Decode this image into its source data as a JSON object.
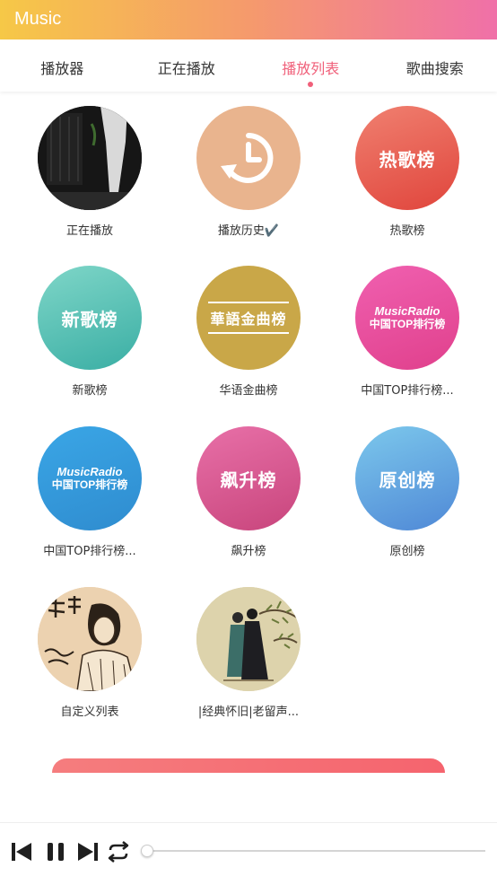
{
  "app": {
    "title": "Music"
  },
  "tabs": [
    {
      "label": "播放器"
    },
    {
      "label": "正在播放"
    },
    {
      "label": "播放列表"
    },
    {
      "label": "歌曲搜索"
    }
  ],
  "active_tab": "播放列表",
  "playlists": [
    {
      "label": "正在播放",
      "cover": "photo-dark-figure"
    },
    {
      "label": "播放历史✔️",
      "cover": "history-clock-icon"
    },
    {
      "label": "热歌榜",
      "cover_text": "热歌榜"
    },
    {
      "label": "新歌榜",
      "cover_text": "新歌榜"
    },
    {
      "label": "华语金曲榜",
      "cover_text": "華語金曲榜"
    },
    {
      "label": "中国TOP排行榜...",
      "cover_text_1": "MusicRadio",
      "cover_text_2": "中国TOP排行榜"
    },
    {
      "label": "中国TOP排行榜...",
      "cover_text_1": "MusicRadio",
      "cover_text_2": "中国TOP排行榜"
    },
    {
      "label": "飙升榜",
      "cover_text": "飙升榜"
    },
    {
      "label": "原创榜",
      "cover_text": "原创榜"
    },
    {
      "label": "自定义列表",
      "cover": "portrait-sketch"
    },
    {
      "label": "|经典怀旧|老留声...",
      "cover": "illustration-couple"
    }
  ],
  "colors": {
    "accent": "#f0607a",
    "hot": "#e65a50",
    "new": "#4dbcb0",
    "gold": "#c9a748",
    "radio_pink": "#ea4f9a",
    "radio_blue": "#3a9ad8",
    "rising": "#d84f8a",
    "original": "#5a9ae0",
    "history": "#e9b48e"
  },
  "player": {
    "prev_icon": "skip-previous-icon",
    "pause_icon": "pause-icon",
    "next_icon": "skip-next-icon",
    "repeat_icon": "repeat-icon",
    "progress": 0
  }
}
